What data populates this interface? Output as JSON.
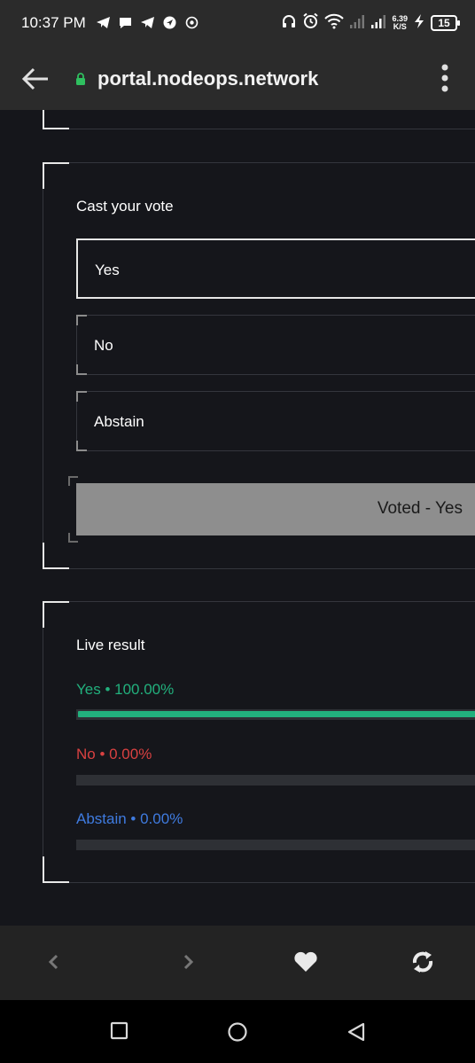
{
  "status_bar": {
    "time": "10:37 PM",
    "net_speed_value": "6.39",
    "net_speed_unit": "K/S",
    "battery_level": "15",
    "icons": [
      "telegram-icon",
      "chat-icon",
      "telegram-icon",
      "location-icon",
      "whatsapp-icon",
      "headphones-icon",
      "alarm-icon",
      "wifi-icon",
      "signal-icon",
      "signal-icon",
      "charging-icon",
      "battery-icon"
    ]
  },
  "browser": {
    "url": "portal.nodeops.network"
  },
  "vote": {
    "title": "Cast your vote",
    "options": [
      {
        "label": "Yes",
        "selected": true
      },
      {
        "label": "No",
        "selected": false
      },
      {
        "label": "Abstain",
        "selected": false
      }
    ],
    "button_label": "Voted - Yes"
  },
  "results": {
    "title": "Live result",
    "items": [
      {
        "label": "Yes • 100.00%",
        "percent": 100,
        "color": "#22b07d"
      },
      {
        "label": "No • 0.00%",
        "percent": 0,
        "color": "#d94141"
      },
      {
        "label": "Abstain • 0.00%",
        "percent": 0,
        "color": "#3f7be0"
      }
    ]
  },
  "colors": {
    "background": "#15161b",
    "card_border": "#34363d",
    "button_bg": "#8e8e8e",
    "yes": "#22b07d",
    "no": "#d94141",
    "abstain": "#3f7be0"
  }
}
